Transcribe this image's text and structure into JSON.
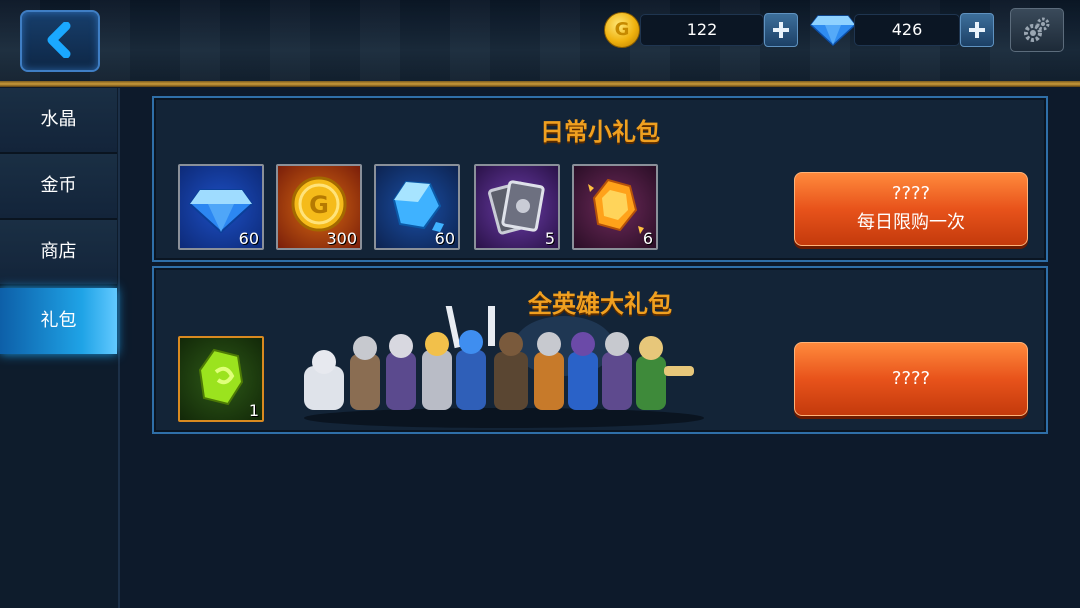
{
  "topbar": {
    "gold": "122",
    "gems": "426",
    "icons": {
      "back": "back-arrow-icon",
      "gold": "gold-coin-icon",
      "gem": "diamond-icon",
      "settings": "gear-icon"
    }
  },
  "sidebar": {
    "items": [
      {
        "label": "水晶",
        "active": false
      },
      {
        "label": "金币",
        "active": false
      },
      {
        "label": "商店",
        "active": false
      },
      {
        "label": "礼包",
        "active": true
      }
    ]
  },
  "packs": [
    {
      "title": "日常小礼包",
      "items": [
        {
          "icon": "blue-diamond-icon",
          "count": "60"
        },
        {
          "icon": "gold-coin-icon",
          "count": "300"
        },
        {
          "icon": "blue-crystal-icon",
          "count": "60"
        },
        {
          "icon": "silver-card-icon",
          "count": "5"
        },
        {
          "icon": "orange-gem-icon",
          "count": "6"
        }
      ],
      "button_line1": "????",
      "button_line2": "每日限购一次"
    },
    {
      "title": "全英雄大礼包",
      "items": [
        {
          "icon": "green-crystal-icon",
          "count": "1"
        }
      ],
      "button_line1": "????"
    }
  ],
  "colors": {
    "accent": "#f0a020",
    "button": "#e8531b",
    "active_tab": "#1fa3e6",
    "panel_border": "#2f6fa8"
  }
}
